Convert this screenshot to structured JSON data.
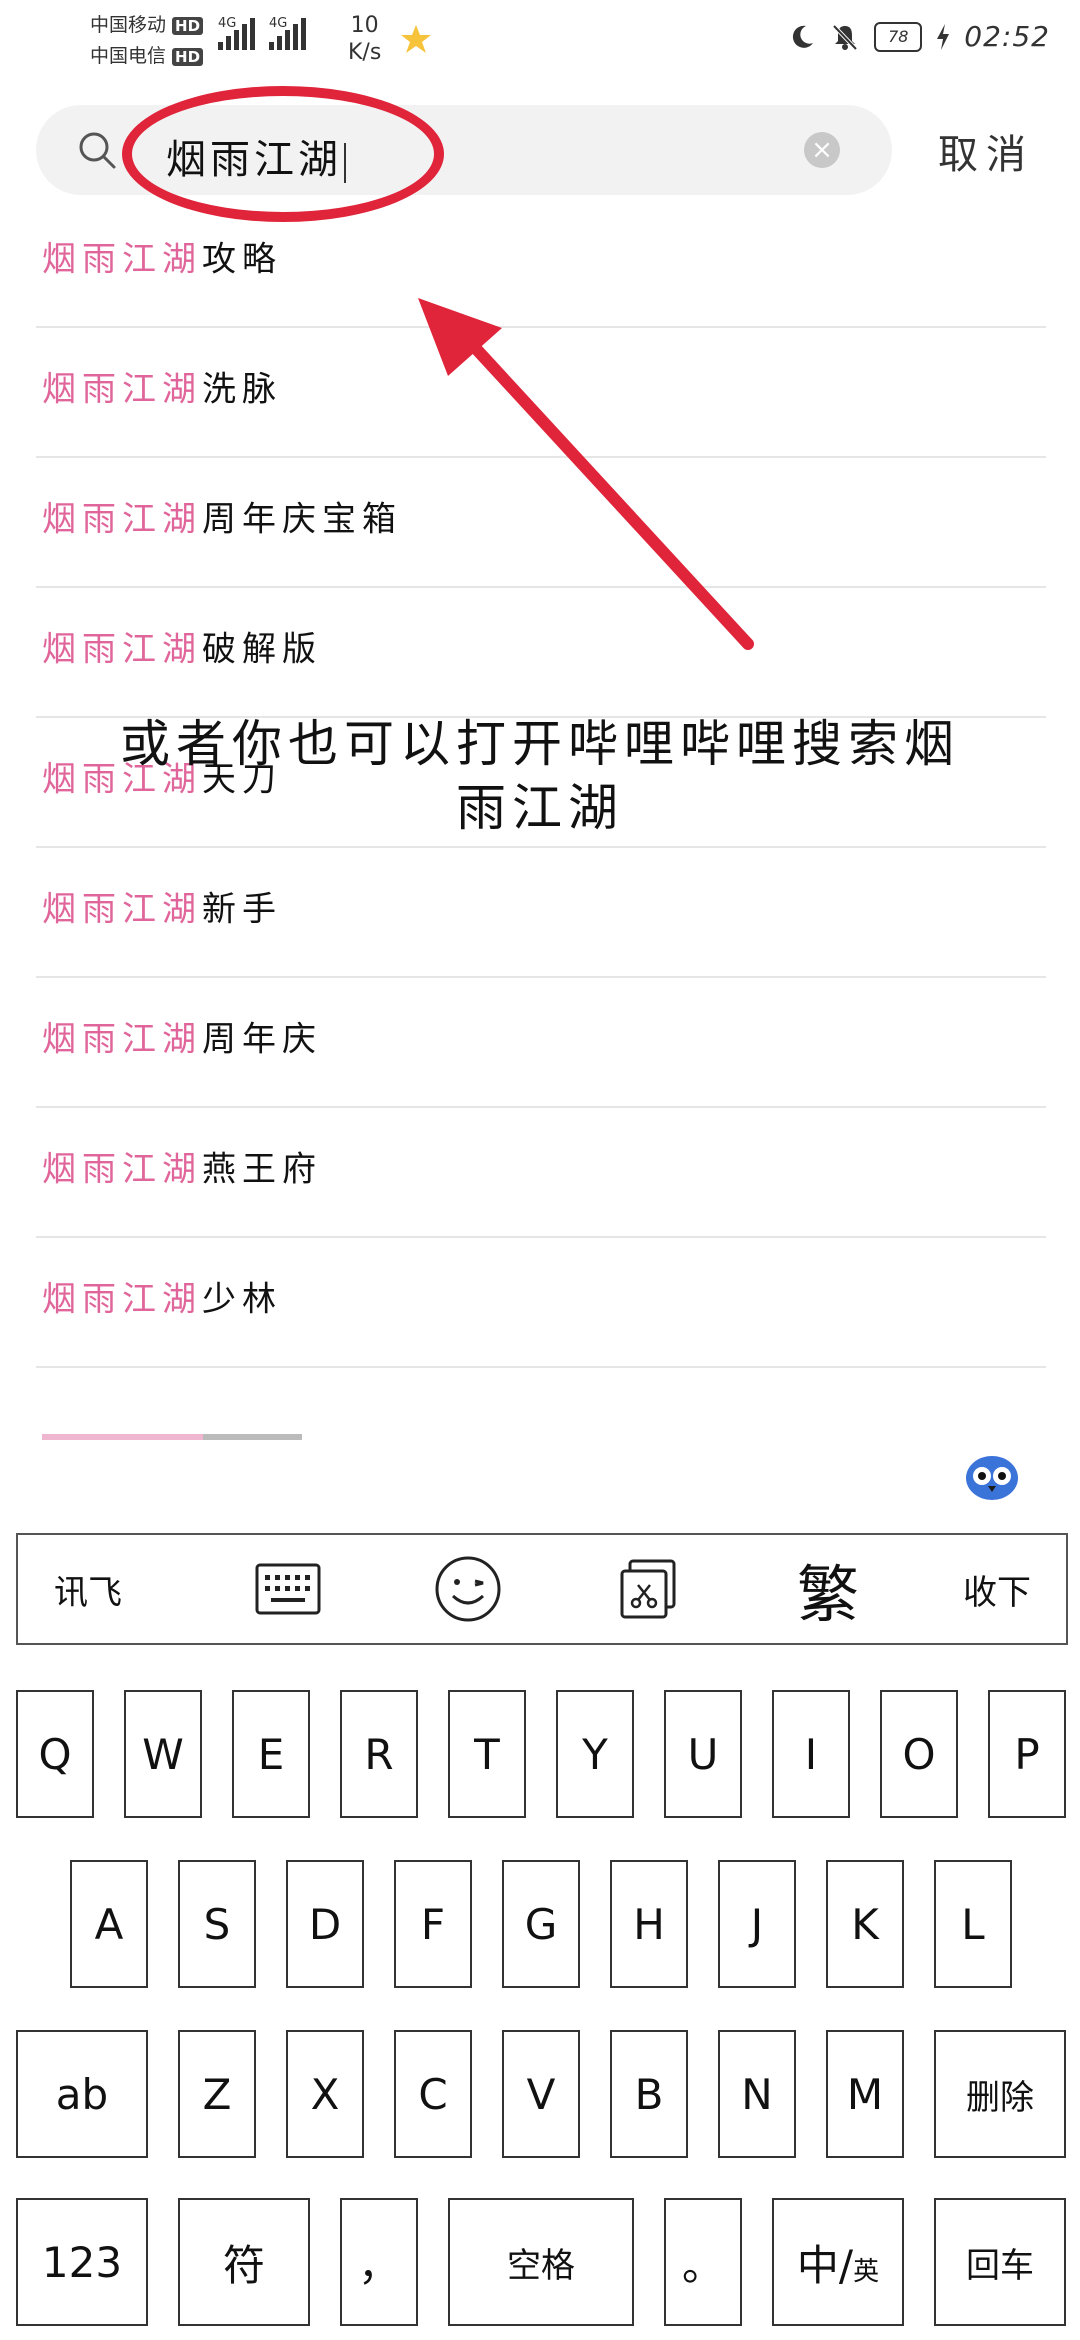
{
  "status_bar": {
    "carrier_1": "中国移动",
    "carrier_2": "中国电信",
    "hd_badge": "HD",
    "network_1": "4G",
    "network_2": "4G",
    "speed_value": "10",
    "speed_unit": "K/s",
    "battery": "78",
    "time": "02:52"
  },
  "search": {
    "query": "烟雨江湖",
    "cancel_label": "取消"
  },
  "suggestions": [
    {
      "highlight": "烟雨江湖",
      "rest": "攻略"
    },
    {
      "highlight": "烟雨江湖",
      "rest": "洗脉"
    },
    {
      "highlight": "烟雨江湖",
      "rest": "周年庆宝箱"
    },
    {
      "highlight": "烟雨江湖",
      "rest": "破解版"
    },
    {
      "highlight": "烟雨江湖",
      "rest": "天刀"
    },
    {
      "highlight": "烟雨江湖",
      "rest": "新手"
    },
    {
      "highlight": "烟雨江湖",
      "rest": "周年庆"
    },
    {
      "highlight": "烟雨江湖",
      "rest": "燕王府"
    },
    {
      "highlight": "烟雨江湖",
      "rest": "少林"
    }
  ],
  "annotation": {
    "text_line1": "或者你也可以打开哔哩哔哩搜索烟",
    "text_line2": "雨江湖",
    "color": "#e0243a"
  },
  "keyboard": {
    "toolbar": {
      "ime_label": "讯飞",
      "keyboard_icon": "keyboard-icon",
      "emoji_icon": "emoji-icon",
      "clipboard_icon": "clipboard-icon",
      "traditional_label": "繁",
      "hide_label": "收下"
    },
    "row1": [
      "Q",
      "W",
      "E",
      "R",
      "T",
      "Y",
      "U",
      "I",
      "O",
      "P"
    ],
    "row2": [
      "A",
      "S",
      "D",
      "F",
      "G",
      "H",
      "J",
      "K",
      "L"
    ],
    "row3": {
      "mode": "ab",
      "letters": [
        "Z",
        "X",
        "C",
        "V",
        "B",
        "N",
        "M"
      ],
      "delete": "删除"
    },
    "row4": {
      "numbers": "123",
      "symbols": "符",
      "comma": "，",
      "space": "空格",
      "period": "。",
      "lang_main": "中/",
      "lang_sub": "英",
      "enter": "回车"
    }
  },
  "colors": {
    "highlight": "#e0659a",
    "search_bg": "#f2f2f2"
  }
}
